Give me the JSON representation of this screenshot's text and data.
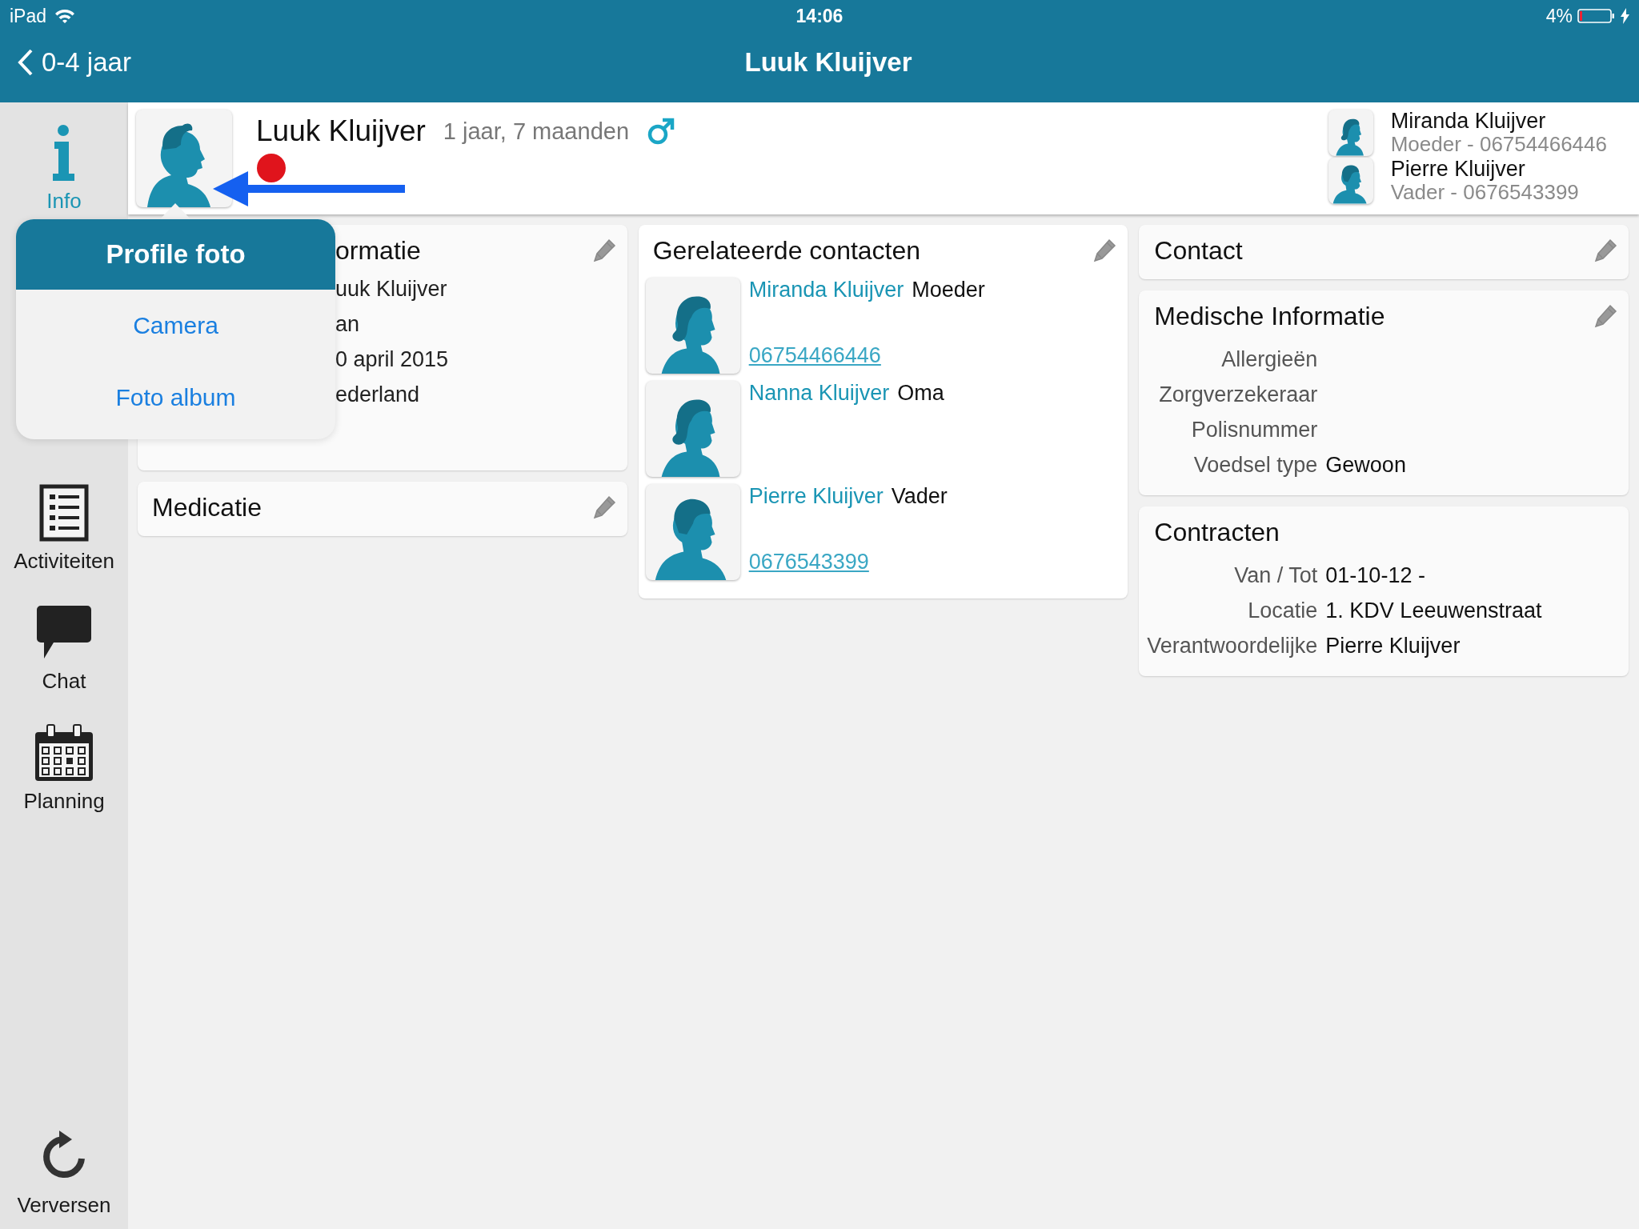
{
  "status_bar": {
    "device": "iPad",
    "time": "14:06",
    "battery": "4%",
    "charging": true
  },
  "nav_bar": {
    "back": "0-4 jaar",
    "title": "Luuk Kluijver"
  },
  "sidebar": {
    "items": [
      {
        "label": "Info",
        "kind": "info",
        "selected": true
      },
      {
        "label": "Activiteiten",
        "kind": "list",
        "selected": false
      },
      {
        "label": "Chat",
        "kind": "chat",
        "selected": false
      },
      {
        "label": "Planning",
        "kind": "calendar",
        "selected": false
      }
    ],
    "refresh": "Verversen"
  },
  "profile": {
    "name": "Luuk Kluijver",
    "age": "1 jaar, 7 maanden",
    "kind": "boy"
  },
  "parents": [
    {
      "name": "Miranda Kluijver",
      "detail": "Moeder - 06754466446",
      "kind": "female"
    },
    {
      "name": "Pierre Kluijver",
      "detail": "Vader - 0676543399",
      "kind": "male"
    }
  ],
  "info_card": {
    "title": "ormatie",
    "editable": true,
    "values": [
      "uuk Kluijver",
      "an",
      "0 april 2015",
      "ederland"
    ]
  },
  "medication_card": {
    "title": "Medicatie",
    "editable": true
  },
  "related_contacts": {
    "title": "Gerelateerde contacten",
    "editable": true,
    "contacts": [
      {
        "name": "Miranda Kluijver",
        "relation": "Moeder",
        "phone": "06754466446",
        "kind": "female"
      },
      {
        "name": "Nanna Kluijver",
        "relation": "Oma",
        "kind": "female"
      },
      {
        "name": "Pierre Kluijver",
        "relation": "Vader",
        "phone": "0676543399",
        "kind": "male"
      }
    ]
  },
  "contact_card": {
    "title": "Contact",
    "editable": true
  },
  "medical_card": {
    "title": "Medische Informatie",
    "editable": true,
    "rows": [
      {
        "label": "Allergieën"
      },
      {
        "label": "Zorgverzekeraar"
      },
      {
        "label": "Polisnummer"
      },
      {
        "label": "Voedsel type",
        "value": "Gewoon"
      }
    ]
  },
  "contracts_card": {
    "title": "Contracten",
    "editable": false,
    "rows": [
      {
        "label": "Van / Tot",
        "value": "01-10-12 -"
      },
      {
        "label": "Locatie",
        "value": "1. KDV Leeuwenstraat"
      },
      {
        "label": "Verantwoordelijke",
        "value": "Pierre Kluijver"
      }
    ]
  },
  "popover": {
    "title": "Profile foto",
    "options": [
      "Camera",
      "Foto album"
    ]
  }
}
